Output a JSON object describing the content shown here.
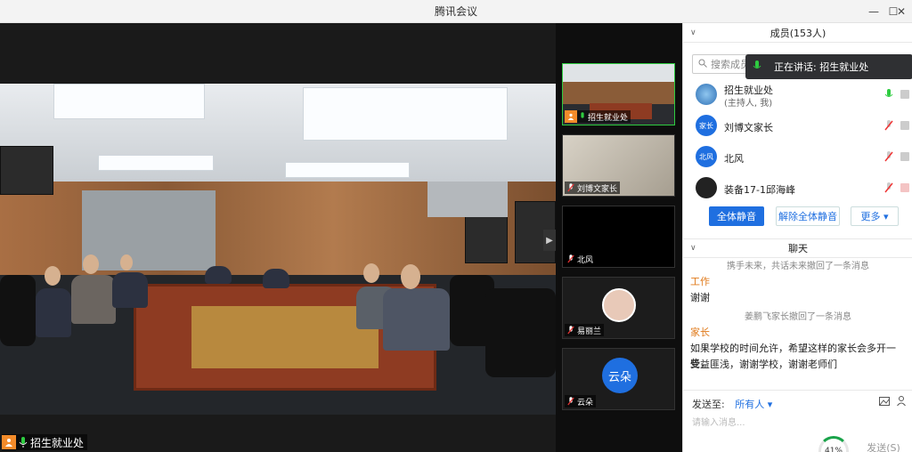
{
  "window": {
    "title": "腾讯会议",
    "minimize": "—",
    "maximize": "☐",
    "close": "✕"
  },
  "main_video": {
    "speaker_name": "招生就业处"
  },
  "thumbnails": [
    {
      "name": "招生就业处",
      "icon": "user-icon"
    },
    {
      "name": "刘博文家长",
      "icon": "mic-off-icon"
    },
    {
      "name": "北风",
      "icon": "mic-off-icon"
    },
    {
      "name": "易丽兰",
      "icon": "mic-off-icon"
    },
    {
      "name": "云朵",
      "icon": "mic-off-icon",
      "avatar_text": "云朵"
    }
  ],
  "members_panel": {
    "title": "成员(153人)",
    "search_placeholder": "搜索成员",
    "speaking_label": "正在讲话: 招生就业处",
    "members": [
      {
        "name": "招生就业处",
        "sub": "(主持人, 我)",
        "avatar_text": ""
      },
      {
        "name": "刘博文家长",
        "sub": "",
        "avatar_text": "家长"
      },
      {
        "name": "北风",
        "sub": "",
        "avatar_text": "北风"
      },
      {
        "name": "装备17-1邱海峰",
        "sub": "",
        "avatar_text": ""
      }
    ],
    "buttons": {
      "mute_all": "全体静音",
      "unmute_all": "解除全体静音",
      "more": "更多 ▾"
    }
  },
  "chat_panel": {
    "title": "聊天",
    "messages": [
      {
        "type": "system",
        "text": "携手未来，共话未来撤回了一条消息"
      },
      {
        "type": "name",
        "text": "工作"
      },
      {
        "type": "msg",
        "text": "谢谢"
      },
      {
        "type": "system",
        "text": "姜鹏飞家长撤回了一条消息"
      },
      {
        "type": "name",
        "text": "家长"
      },
      {
        "type": "msg",
        "text": "如果学校的时间允许，希望这样的家长会多开一些，"
      },
      {
        "type": "msg",
        "text": "受益匪浅，谢谢学校，谢谢老师们"
      }
    ],
    "send_to_label": "发送至:",
    "send_to_value": "所有人 ▾",
    "input_placeholder": "请输入消息...",
    "progress": "41%",
    "send_label": "发送(S)"
  },
  "colors": {
    "accent": "#1f6fe0",
    "name_orange": "#e07a1b",
    "green": "#1aa34a"
  }
}
